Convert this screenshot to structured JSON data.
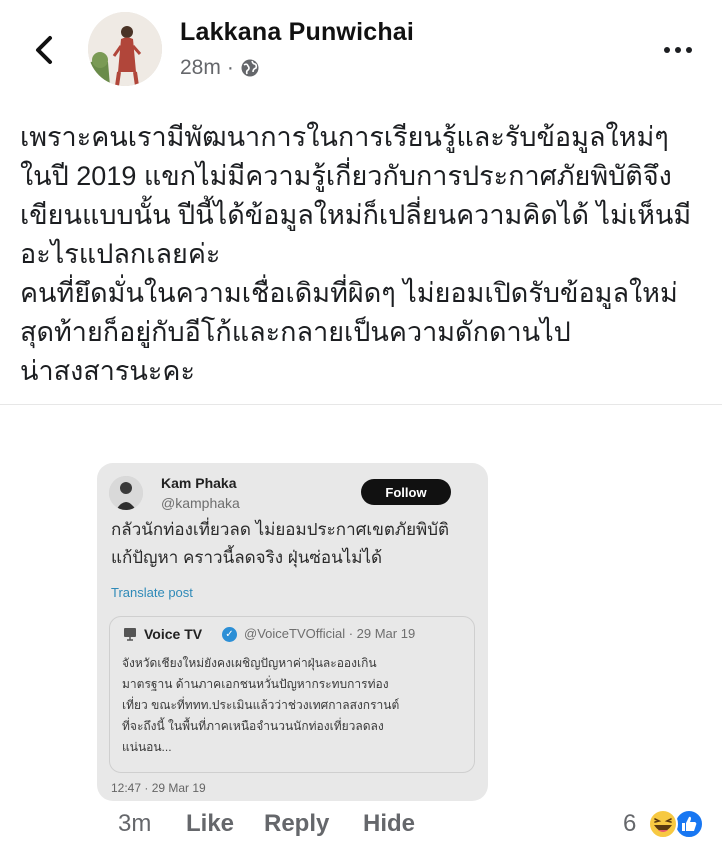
{
  "header": {
    "author_name": "Lakkana Punwichai",
    "timestamp": "28m",
    "separator": "·",
    "audience_icon": "globe-icon",
    "back_icon": "back-arrow-icon",
    "more_icon": "more-dots-icon"
  },
  "post": {
    "text": "เพราะคนเรามีพัฒนาการในการเรียนรู้และรับข้อมูลใหม่ๆ\nในปี 2019 แขกไม่มีความรู้เกี่ยวกับการประกาศภัยพิบัติจึง\nเขียนแบบนั้น ปีนี้ได้ข้อมูลใหม่ก็เปลี่ยนความคิดได้ ไม่เห็นมี\nอะไรแปลกเลยค่ะ\nคนที่ยึดมั่นในความเชื่อเดิมที่ผิดๆ ไม่ยอมเปิดรับข้อมูลใหม่\nสุดท้ายก็อยู่กับอีโก้และกลายเป็นความดักดานไป\nน่าสงสารนะคะ"
  },
  "tweet": {
    "name": "Kam Phaka",
    "handle": "@kamphaka",
    "follow_label": "Follow",
    "text": "กลัวนักท่องเที่ยวลด ไม่ยอมประกาศเขตภัยพิบัติ\nแก้ปัญหา คราวนี้ลดจริง ฝุ่นซ่อนไม่ได้",
    "translate_label": "Translate post",
    "time": "12:47 · 29 Mar 19",
    "quote": {
      "name": "Voice TV",
      "meta": "@VoiceTVOfficial · 29 Mar 19",
      "text": "จังหวัดเชียงใหม่ยังคงเผชิญปัญหาค่าฝุ่นละอองเกิน\nมาตรฐาน ด้านภาคเอกชนหวั่นปัญหากระทบการท่อง\nเที่ยว ขณะที่ททท.ประเมินแล้วว่าช่วงเทศกาลสงกรานต์\nที่จะถึงนี้ ในพื้นที่ภาคเหนือจำนวนนักท่องเที่ยวลดลง\nแน่นอน..."
    }
  },
  "comment_actions": {
    "time": "3m",
    "like_label": "Like",
    "reply_label": "Reply",
    "hide_label": "Hide",
    "reaction_count": "6",
    "reaction_icons": [
      "haha-emoji-icon",
      "like-thumb-icon"
    ]
  },
  "colors": {
    "text": "#1c1e21",
    "muted": "#65676b",
    "like_blue": "#1877f2",
    "haha_yellow": "#f7c942",
    "verified_blue": "#2c8fd6",
    "translate_blue": "#2f8ab8"
  }
}
